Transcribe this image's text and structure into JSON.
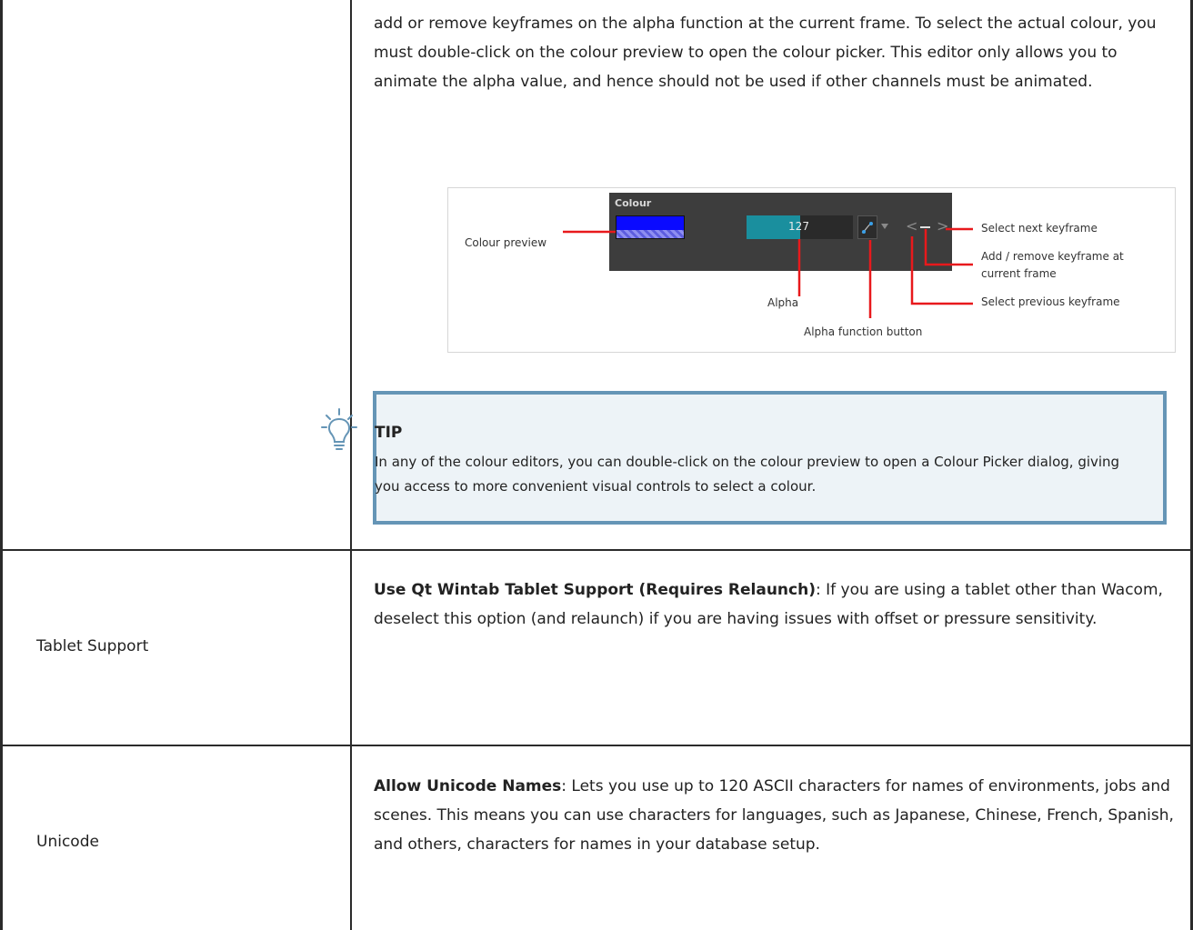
{
  "row_colour": {
    "description": "add or remove keyframes on the alpha function at the current frame. To select the actual colour, you must double-click on the colour preview to open the colour picker. This editor only allows you to animate the alpha value, and hence should not be used if other channels must be animated."
  },
  "figure": {
    "panel_title": "Colour",
    "alpha_value": "127",
    "alpha_level": 0.5,
    "swatch_color": "#0a0aff",
    "callout_color": "#e8191c",
    "labels": {
      "colour_preview": "Colour preview",
      "alpha": "Alpha",
      "alpha_function_button": "Alpha function button",
      "select_next_keyframe": "Select next keyframe",
      "add_remove_keyframe_1": "Add / remove keyframe at",
      "add_remove_keyframe_2": "current frame",
      "select_previous_keyframe": "Select previous keyframe"
    }
  },
  "tip": {
    "title": "TIP",
    "body": "In any of the colour editors, you can double-click on the colour preview to open a Colour Picker dialog, giving you access to more convenient visual controls to select a colour.",
    "accent_color": "#6595b6",
    "icon": "lightbulb-icon"
  },
  "row_tablet": {
    "label": "Tablet Support",
    "option": "Use Qt Wintab Tablet Support (Requires Relaunch)",
    "description": ": If you are using a tablet other than Wacom, deselect this option (and relaunch) if you are having issues with offset or pressure sensitivity."
  },
  "row_unicode": {
    "label": "Unicode",
    "option": "Allow Unicode Names",
    "description": ": Lets you use up to 120 ASCII characters for names of environments, jobs and scenes. This means you can use characters for languages, such as Japanese, Chinese, French, Spanish, and others, characters for names in your database setup."
  }
}
